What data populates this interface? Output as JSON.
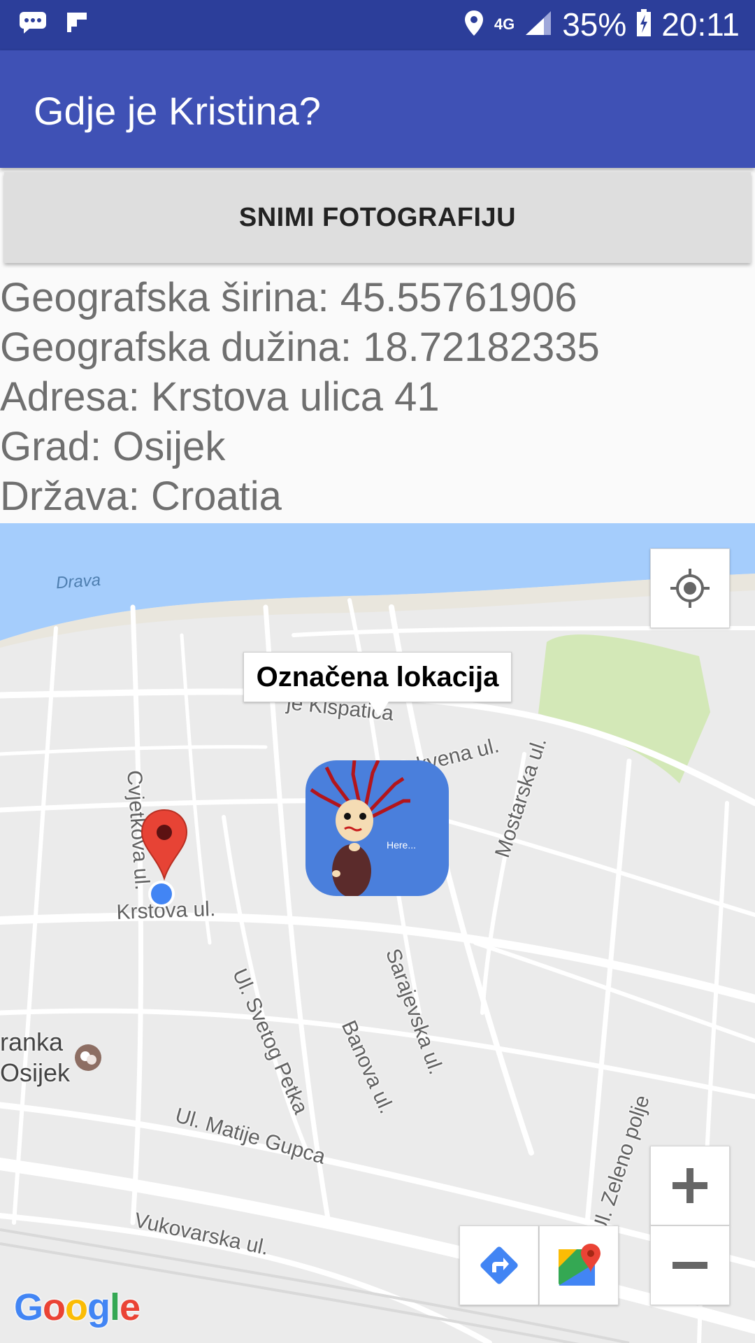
{
  "status_bar": {
    "battery": "35%",
    "time": "20:11",
    "network": "4G",
    "icons": [
      "message-icon",
      "flipboard-icon",
      "location-pin-icon",
      "network-4g-icon",
      "signal-icon",
      "battery-charging-icon"
    ]
  },
  "app_bar": {
    "title": "Gdje je Kristina?"
  },
  "capture_button": {
    "label": "SNIMI FOTOGRAFIJU"
  },
  "info": {
    "latitude": "Geografska širina: 45.55761906",
    "longitude": "Geografska dužina: 18.72182335",
    "address": "Adresa: Krstova ulica 41",
    "city": "Grad: Osijek",
    "country": "Država: Croatia"
  },
  "map": {
    "info_window": "Označena lokacija",
    "marker_caption": "Here...",
    "water_label": "Drava",
    "streets": {
      "cvjetkova": "Cvjetkova ul.",
      "krstova": "Krstova ul.",
      "kispaticeva": "je Kispatića",
      "crkvena": "Crkvena ul.",
      "mostarska": "Mostarska ul.",
      "svetog_petka": "Ul. Svetog Petka",
      "banova": "Banova ul.",
      "sarajevska": "Sarajevska ul.",
      "matije_gupca": "Ul. Matije Gupca",
      "vukovarska": "Vukovarska ul.",
      "zeleno_polje": "Ul. Zeleno polje"
    },
    "poi_line1": "ranka",
    "poi_line2": "Osijek",
    "logo": "Google",
    "colors": {
      "water": "#a5cdfc",
      "park": "#d3e8b7",
      "land": "#ebebeb",
      "road": "#ffffff",
      "marker": "#e74335",
      "accent": "#3f51b5"
    }
  }
}
